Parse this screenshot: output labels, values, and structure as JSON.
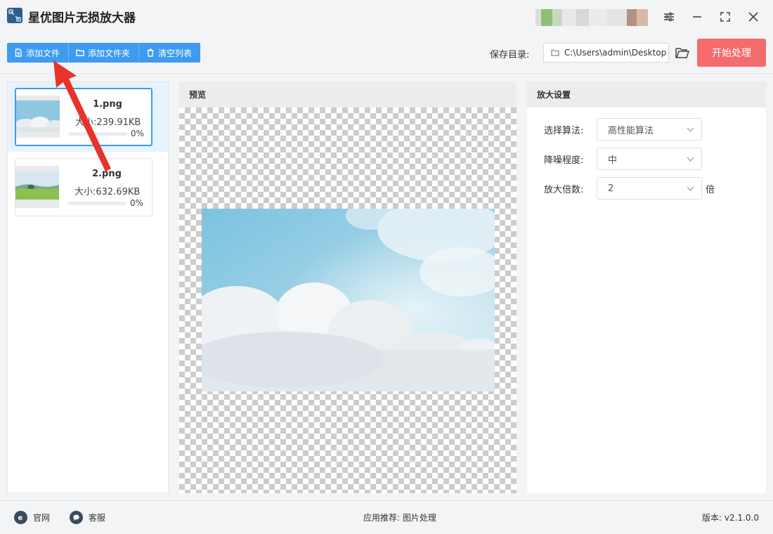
{
  "app": {
    "title": "星优图片无损放大器"
  },
  "toolbar": {
    "add_file": "添加文件",
    "add_folder": "添加文件夹",
    "clear_list": "清空列表",
    "save_dir_label": "保存目录:",
    "save_dir_value": "C:\\Users\\admin\\Desktop",
    "start_button": "开始处理"
  },
  "files": [
    {
      "name": "1.png",
      "size": "大小:239.91KB",
      "progress_label": "0%",
      "progress": 0,
      "selected": true
    },
    {
      "name": "2.png",
      "size": "大小:632.69KB",
      "progress_label": "0%",
      "progress": 0,
      "selected": false
    }
  ],
  "preview": {
    "title": "预览"
  },
  "settings": {
    "title": "放大设置",
    "algorithm_label": "选择算法:",
    "algorithm_value": "高性能算法",
    "denoise_label": "降噪程度:",
    "denoise_value": "中",
    "scale_label": "放大倍数:",
    "scale_value": "2",
    "scale_suffix": "倍"
  },
  "footer": {
    "website": "官网",
    "support": "客服",
    "recommend": "应用推荐:  图片处理",
    "version": "版本:  v2.1.0.0"
  },
  "colors": {
    "accent": "#3d9bf0",
    "start_button": "#f56c6c",
    "annotation_arrow": "#e8322b"
  }
}
